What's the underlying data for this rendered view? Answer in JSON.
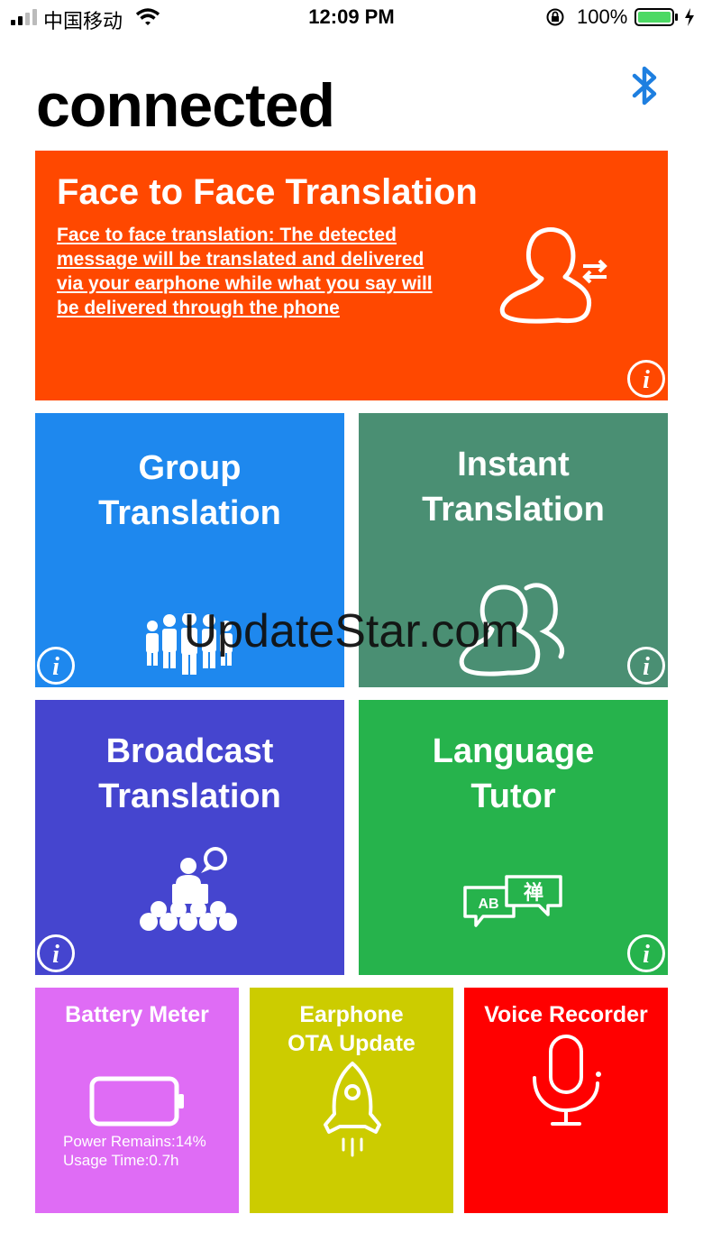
{
  "status_bar": {
    "carrier": "中国移动",
    "time": "12:09 PM",
    "battery_percent": "100%"
  },
  "header": {
    "title": "connected",
    "bluetooth_icon": "bluetooth-icon"
  },
  "tiles": {
    "face_to_face": {
      "title": "Face to Face Translation",
      "description": "Face to face translation: The detected message will be translated and delivered via your earphone while what you say will be delivered through the phone",
      "color": "#ff4800",
      "icon": "person-swap-icon"
    },
    "group": {
      "title_line1": "Group",
      "title_line2": "Translation",
      "color": "#1e88ee",
      "icon": "group-people-icon"
    },
    "instant": {
      "title_line1": "Instant",
      "title_line2": "Translation",
      "color": "#4a8f73",
      "icon": "two-persons-icon"
    },
    "broadcast": {
      "title_line1": "Broadcast",
      "title_line2": "Translation",
      "color": "#4545cf",
      "icon": "speaker-audience-icon"
    },
    "tutor": {
      "title_line1": "Language",
      "title_line2": "Tutor",
      "color": "#26b34c",
      "icon": "language-bubbles-icon",
      "bubble_left": "AB",
      "bubble_right": "禅"
    },
    "battery": {
      "title": "Battery Meter",
      "power_remains": "Power Remains:14%",
      "usage_time": "Usage Time:0.7h",
      "color": "#df6cf5",
      "icon": "battery-icon"
    },
    "ota": {
      "title_line1": "Earphone",
      "title_line2": "OTA Update",
      "color": "#cccc00",
      "icon": "rocket-icon"
    },
    "voice": {
      "title": "Voice Recorder",
      "color": "#ff0000",
      "icon": "microphone-icon"
    }
  },
  "watermark": "UpdateStar.com"
}
